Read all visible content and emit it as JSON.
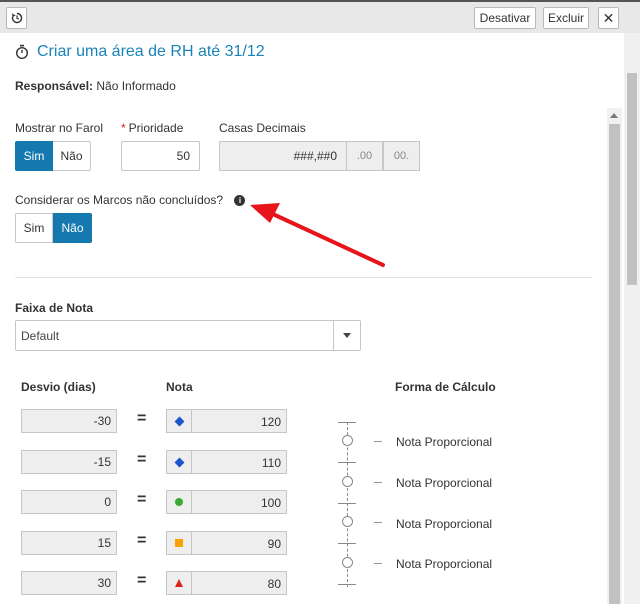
{
  "toolbar": {
    "deactivate_label": "Desativar",
    "delete_label": "Excluir"
  },
  "header": {
    "title": "Criar uma área de RH até 31/12"
  },
  "responsible": {
    "label": "Responsável:",
    "value": "Não Informado"
  },
  "show_in_lighthouse": {
    "label": "Mostrar no Farol",
    "options": [
      "Sim",
      "Não"
    ],
    "selected": "Sim"
  },
  "priority": {
    "label": "Prioridade",
    "required_mark": "*",
    "value": "50"
  },
  "decimals": {
    "label": "Casas Decimais",
    "value": "###,##0",
    "buttons": [
      ".00",
      "00."
    ]
  },
  "consider_milestones": {
    "label": "Considerar os Marcos não concluídos?",
    "options": [
      "Sim",
      "Não"
    ],
    "selected": "Não"
  },
  "grade_range": {
    "label": "Faixa de Nota",
    "selected": "Default"
  },
  "table": {
    "col_deviation": "Desvio (dias)",
    "col_grade": "Nota",
    "col_calc": "Forma de Cálculo",
    "equals": "=",
    "rows": [
      {
        "deviation": "-30",
        "icon": "blue-diamond-icon",
        "grade": "120"
      },
      {
        "deviation": "-15",
        "icon": "blue-diamond-icon",
        "grade": "110"
      },
      {
        "deviation": "0",
        "icon": "green-circle-icon",
        "grade": "100"
      },
      {
        "deviation": "15",
        "icon": "orange-square-icon",
        "grade": "90"
      },
      {
        "deviation": "30",
        "icon": "red-triangle-icon",
        "grade": "80"
      }
    ],
    "calc_methods": [
      "Nota Proporcional",
      "Nota Proporcional",
      "Nota Proporcional",
      "Nota Proporcional"
    ]
  },
  "colors": {
    "accent": "#1578ae",
    "title": "#1a83b7",
    "arrow": "#e8141b"
  }
}
